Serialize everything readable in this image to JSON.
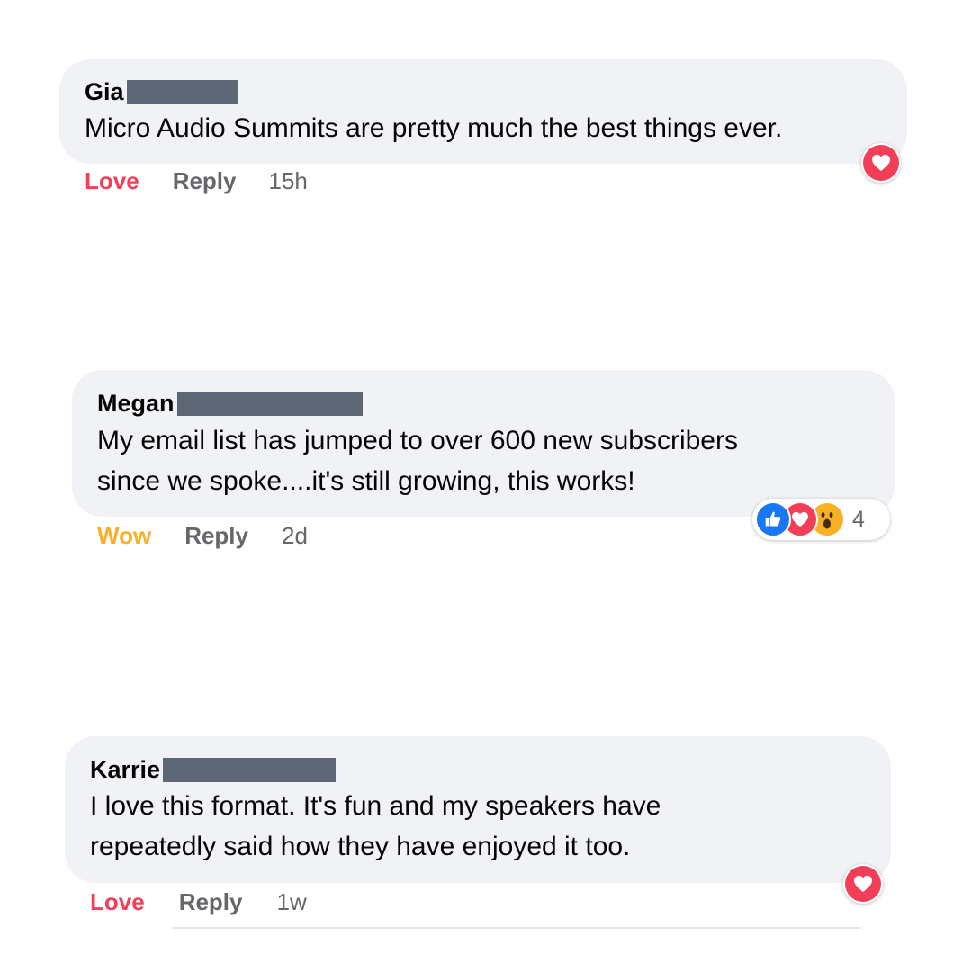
{
  "comments": [
    {
      "author": "Gia",
      "text": [
        "Micro Audio Summits are pretty much the best things ever."
      ],
      "reaction_label": "Love",
      "reply_label": "Reply",
      "time": "15h",
      "badge": "heart-icon"
    },
    {
      "author": "Megan",
      "text": [
        "My email list has jumped to over 600 new subscribers",
        "since we spoke....it's still growing, this works!"
      ],
      "reaction_label": "Wow",
      "reply_label": "Reply",
      "time": "2d",
      "badge_count": "4"
    },
    {
      "author": "Karrie",
      "text": [
        "I love this format. It's fun and my speakers have",
        "repeatedly said how they have enjoyed it too."
      ],
      "reaction_label": "Love",
      "reply_label": "Reply",
      "time": "1w",
      "badge": "heart-icon"
    }
  ],
  "colors": {
    "love": "#f33e58",
    "wow": "#f7b125",
    "like": "#1877f2",
    "bubble": "#f0f2f5",
    "secondary_text": "#65676b",
    "redaction": "#5e6776"
  }
}
